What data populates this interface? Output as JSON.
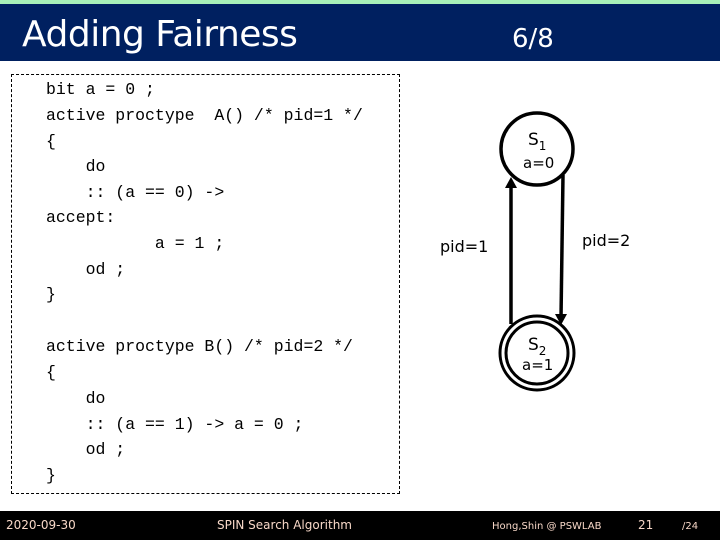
{
  "header": {
    "title": "Adding Fairness",
    "slide_counter": "6/8",
    "colors": {
      "strip": "#a8f0b8",
      "background": "#002060",
      "text": "#ffffff"
    }
  },
  "code": {
    "lines": [
      "bit a = 0 ;",
      "active proctype  A() /* pid=1 */",
      "{",
      "    do",
      "    :: (a == 0) ->",
      "accept:",
      "           a = 1 ;",
      "    od ;",
      "}",
      "",
      "active proctype B() /* pid=2 */",
      "{",
      "    do",
      "    :: (a == 1) -> a = 0 ;",
      "    od ;",
      "}"
    ]
  },
  "diagram": {
    "states": [
      {
        "id": "S1",
        "label": "S",
        "subscript": "1",
        "value": "a=0",
        "accepting": false
      },
      {
        "id": "S2",
        "label": "S",
        "subscript": "2",
        "value": "a=1",
        "accepting": true
      }
    ],
    "transitions": [
      {
        "from": "S2",
        "to": "S1",
        "label": "pid=1"
      },
      {
        "from": "S1",
        "to": "S2",
        "label": "pid=2"
      }
    ]
  },
  "footer": {
    "date": "2020-09-30",
    "topic": "SPIN Search Algorithm",
    "author": "Hong,Shin @ PSWLAB",
    "page": "21",
    "total": "/24",
    "colors": {
      "background": "#000000",
      "text": "#f8d8c8"
    }
  }
}
